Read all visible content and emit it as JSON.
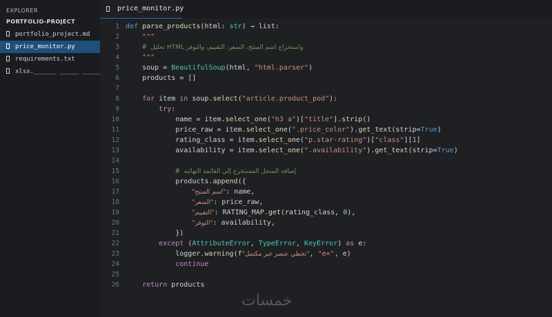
{
  "sidebar": {
    "explorer_title": "EXPLORER",
    "project_title": "PORTFOLIO-PROJECT",
    "files": [
      {
        "label": "portfolio_project.md",
        "active": false
      },
      {
        "label": "price_monitor.py",
        "active": true
      },
      {
        "label": "requirements.txt",
        "active": false
      },
      {
        "label": "xlsx.______ _____ _____",
        "active": false
      }
    ]
  },
  "tab": {
    "label": "price_monitor.py"
  },
  "line_numbers": [
    "1",
    "2",
    "3",
    "4",
    "5",
    "6",
    "7",
    "8",
    "9",
    "10",
    "11",
    "12",
    "13",
    "14",
    "15",
    "16",
    "17",
    "18",
    "19",
    "20",
    "21",
    "22",
    "23",
    "24",
    "25",
    "26"
  ],
  "code": {
    "l1": {
      "def": "def",
      "name": "parse_products",
      "p1": "(html: ",
      "type": "str",
      "p2": ") → list:"
    },
    "l2": {
      "doc": "\"\"\""
    },
    "l3": {
      "hash": "#",
      "text": "تحليل HTML واستخراج اسم المنتج، السعر، التقييم، والتوفر"
    },
    "l4": {
      "doc": "\"\"\""
    },
    "l5": {
      "a": "soup = ",
      "fn": "BeautifulSoup",
      "b": "(html, ",
      "s": "\"html.parser\"",
      "c": ")"
    },
    "l6": {
      "a": "products = []"
    },
    "l8": {
      "for": "for",
      "a": " item ",
      "in": "in",
      "b": " soup.",
      "fn": "select",
      "c": "(",
      "s": "\"article.product_pod\"",
      "d": "):"
    },
    "l9": {
      "try": "try",
      "a": ":"
    },
    "l10": {
      "a": "name = item.",
      "fn1": "select_one",
      "b": "(",
      "s1": "\"h3 a\"",
      "c": ")[",
      "s2": "\"title\"",
      "d": "].",
      "fn2": "strip",
      "e": "()"
    },
    "l11": {
      "a": "price_raw = item.",
      "fn1": "select_one",
      "b": "(",
      "s1": "\".price_color\"",
      "c": ").",
      "fn2": "get_text",
      "d": "(strip=",
      "t": "True",
      "e": ")"
    },
    "l12": {
      "a": "rating_class = item.",
      "fn1": "select_one",
      "b": "(",
      "s1": "\"p.star-rating\"",
      "c": ")[",
      "s2": "\"class\"",
      "d": "][",
      "n": "1",
      "e": "]"
    },
    "l13": {
      "a": "availability = item.",
      "fn1": "select_one",
      "b": "(",
      "s1": "\".availability\"",
      "c": ").",
      "fn2": "get_text",
      "d": "(strip=",
      "t": "True",
      "e": ")"
    },
    "l15": {
      "hash": "#",
      "text": "إضافة السجل المستخرج إلى القائمة النهائية"
    },
    "l16": {
      "a": "products.",
      "fn": "append",
      "b": "({"
    },
    "l17": {
      "s": "\"اسم المنتج\"",
      "a": ": name,"
    },
    "l18": {
      "s": "\"السعر\"",
      "a": ": price_raw,"
    },
    "l19": {
      "s": "\"التقييم\"",
      "a": ": RATING_MAP.",
      "fn": "get",
      "b": "(rating_class, ",
      "n": "0",
      "c": "),"
    },
    "l20": {
      "s": "\"التوفر\"",
      "a": ": availability,"
    },
    "l21": {
      "a": "})"
    },
    "l22": {
      "except": "except",
      "a": " (",
      "t1": "AttributeError",
      "b": ", ",
      "t2": "TypeError",
      "c": ", ",
      "t3": "KeyError",
      "d": ") ",
      "as": "as",
      "e": " e:"
    },
    "l23": {
      "a": "logger.",
      "fn": "warning",
      "b": "(f",
      "s1": "\"تخطي عنصر غير مكتمل\"",
      "c": ", ",
      "s2": "\"e=\"",
      "d": ", e)"
    },
    "l24": {
      "cont": "continue"
    },
    "l26": {
      "ret": "return",
      "a": " products"
    }
  },
  "watermark": "خمسات",
  "colors": {
    "accent": "#1f4f7a",
    "keyword": "#569cd6",
    "control": "#c586c0",
    "function": "#dcdcaa",
    "type": "#4ec9b0",
    "string": "#ce9178",
    "comment": "#6a9955"
  }
}
